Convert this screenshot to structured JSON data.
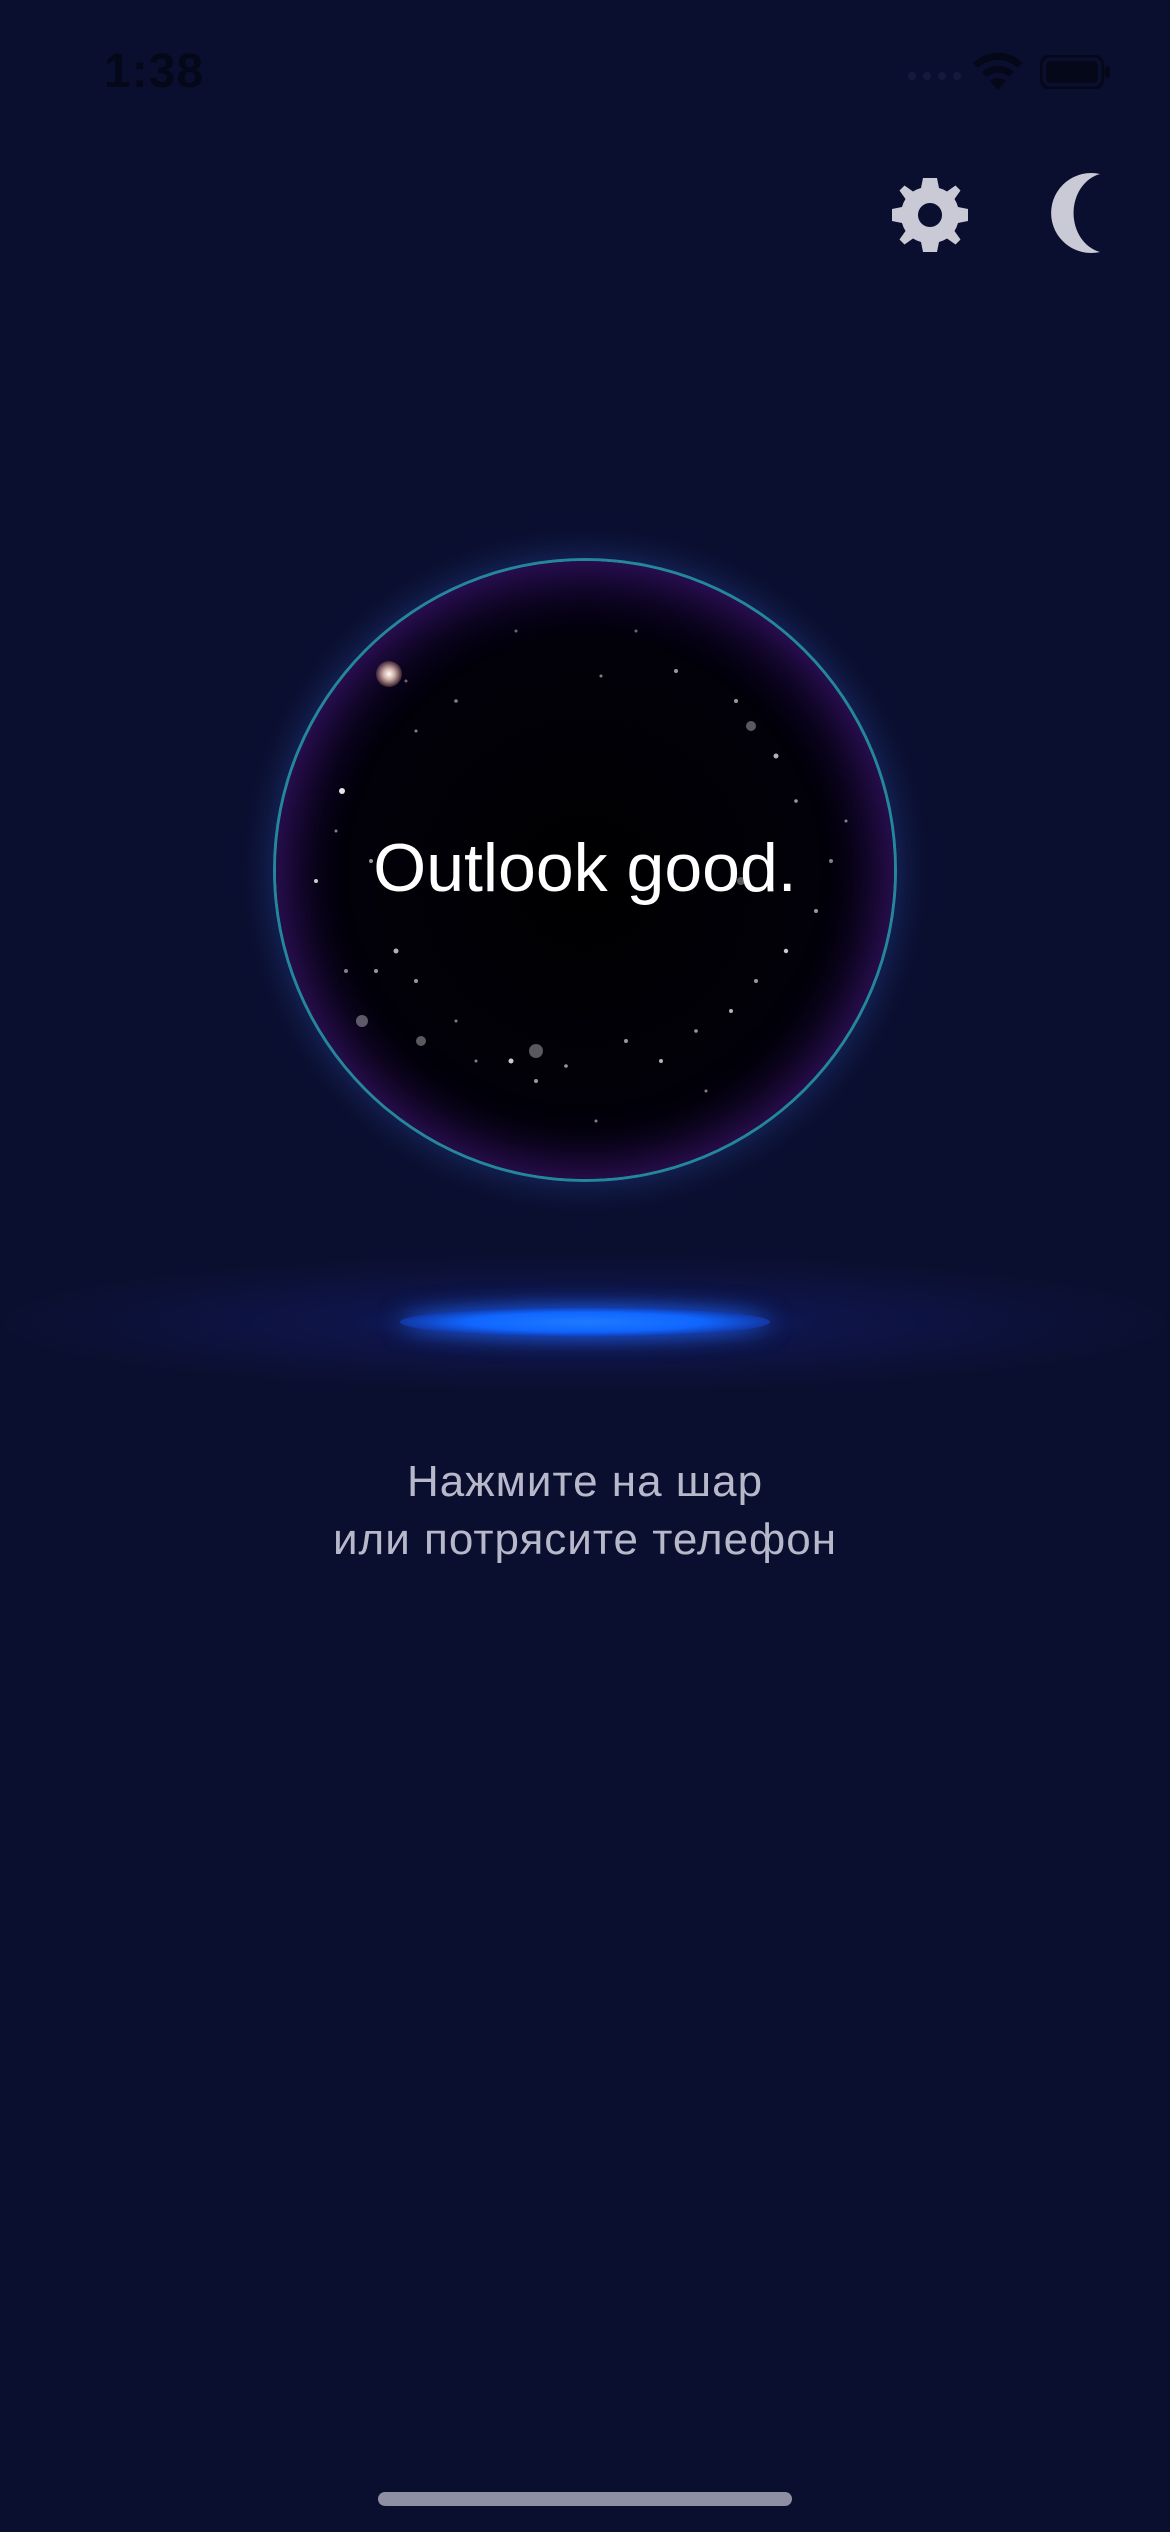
{
  "status_bar": {
    "time": "1:38",
    "wifi_icon": "wifi-icon",
    "battery_icon": "battery-icon"
  },
  "toolbar": {
    "settings_icon": "gear-icon",
    "theme_icon": "moon-icon"
  },
  "ball": {
    "answer": "Outlook good."
  },
  "instruction": {
    "line1": "Нажмите на шар",
    "line2": "или потрясите телефон"
  },
  "colors": {
    "background": "#0b0f2f",
    "ball_rim_cyan": "#1fd4d0",
    "ball_purple": "#c23bd1",
    "glow_blue": "#1e7bff",
    "icon_gray": "#c9cad6",
    "instruction_text": "#b7b9cb"
  }
}
